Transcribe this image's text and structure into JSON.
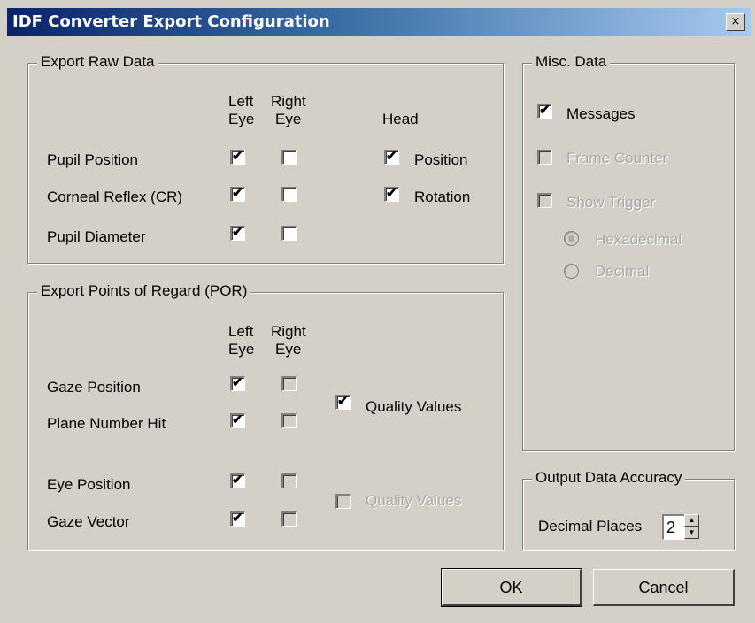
{
  "window": {
    "title": "IDF Converter Export Configuration",
    "close_label": "×"
  },
  "raw": {
    "legend": "Export Raw Data",
    "col_left": [
      "Left",
      "Eye"
    ],
    "col_right": [
      "Right",
      "Eye"
    ],
    "col_head": "Head",
    "rows": [
      "Pupil Position",
      "Corneal Reflex (CR)",
      "Pupil Diameter"
    ],
    "head_position": "Position",
    "head_rotation": "Rotation"
  },
  "por": {
    "legend": "Export Points of Regard (POR)",
    "col_left": [
      "Left",
      "Eye"
    ],
    "col_right": [
      "Right",
      "Eye"
    ],
    "rows": [
      "Gaze Position",
      "Plane Number Hit",
      "Eye Position",
      "Gaze Vector"
    ],
    "quality_1": "Quality Values",
    "quality_2": "Quality Values"
  },
  "misc": {
    "legend": "Misc. Data",
    "messages": "Messages",
    "frame_counter": "Frame Counter",
    "show_trigger": "Show Trigger",
    "hexadecimal": "Hexadecimal",
    "decimal": "Decimal"
  },
  "accuracy": {
    "legend": "Output Data Accuracy",
    "label": "Decimal Places",
    "value": "2"
  },
  "buttons": {
    "ok": "OK",
    "cancel": "Cancel"
  },
  "state": {
    "raw_pupil_left": true,
    "raw_pupil_right": false,
    "raw_cr_left": true,
    "raw_cr_right": false,
    "raw_diam_left": true,
    "raw_diam_right": false,
    "head_position": true,
    "head_rotation": true,
    "por_gaze_left": true,
    "por_gaze_right": false,
    "por_plane_left": true,
    "por_plane_right": false,
    "por_eye_left": true,
    "por_eye_right": false,
    "por_vector_left": true,
    "por_vector_right": false,
    "quality_1": true,
    "quality_2": false,
    "messages": true,
    "frame_counter": false,
    "show_trigger": false,
    "trigger_format": "Hexadecimal"
  }
}
